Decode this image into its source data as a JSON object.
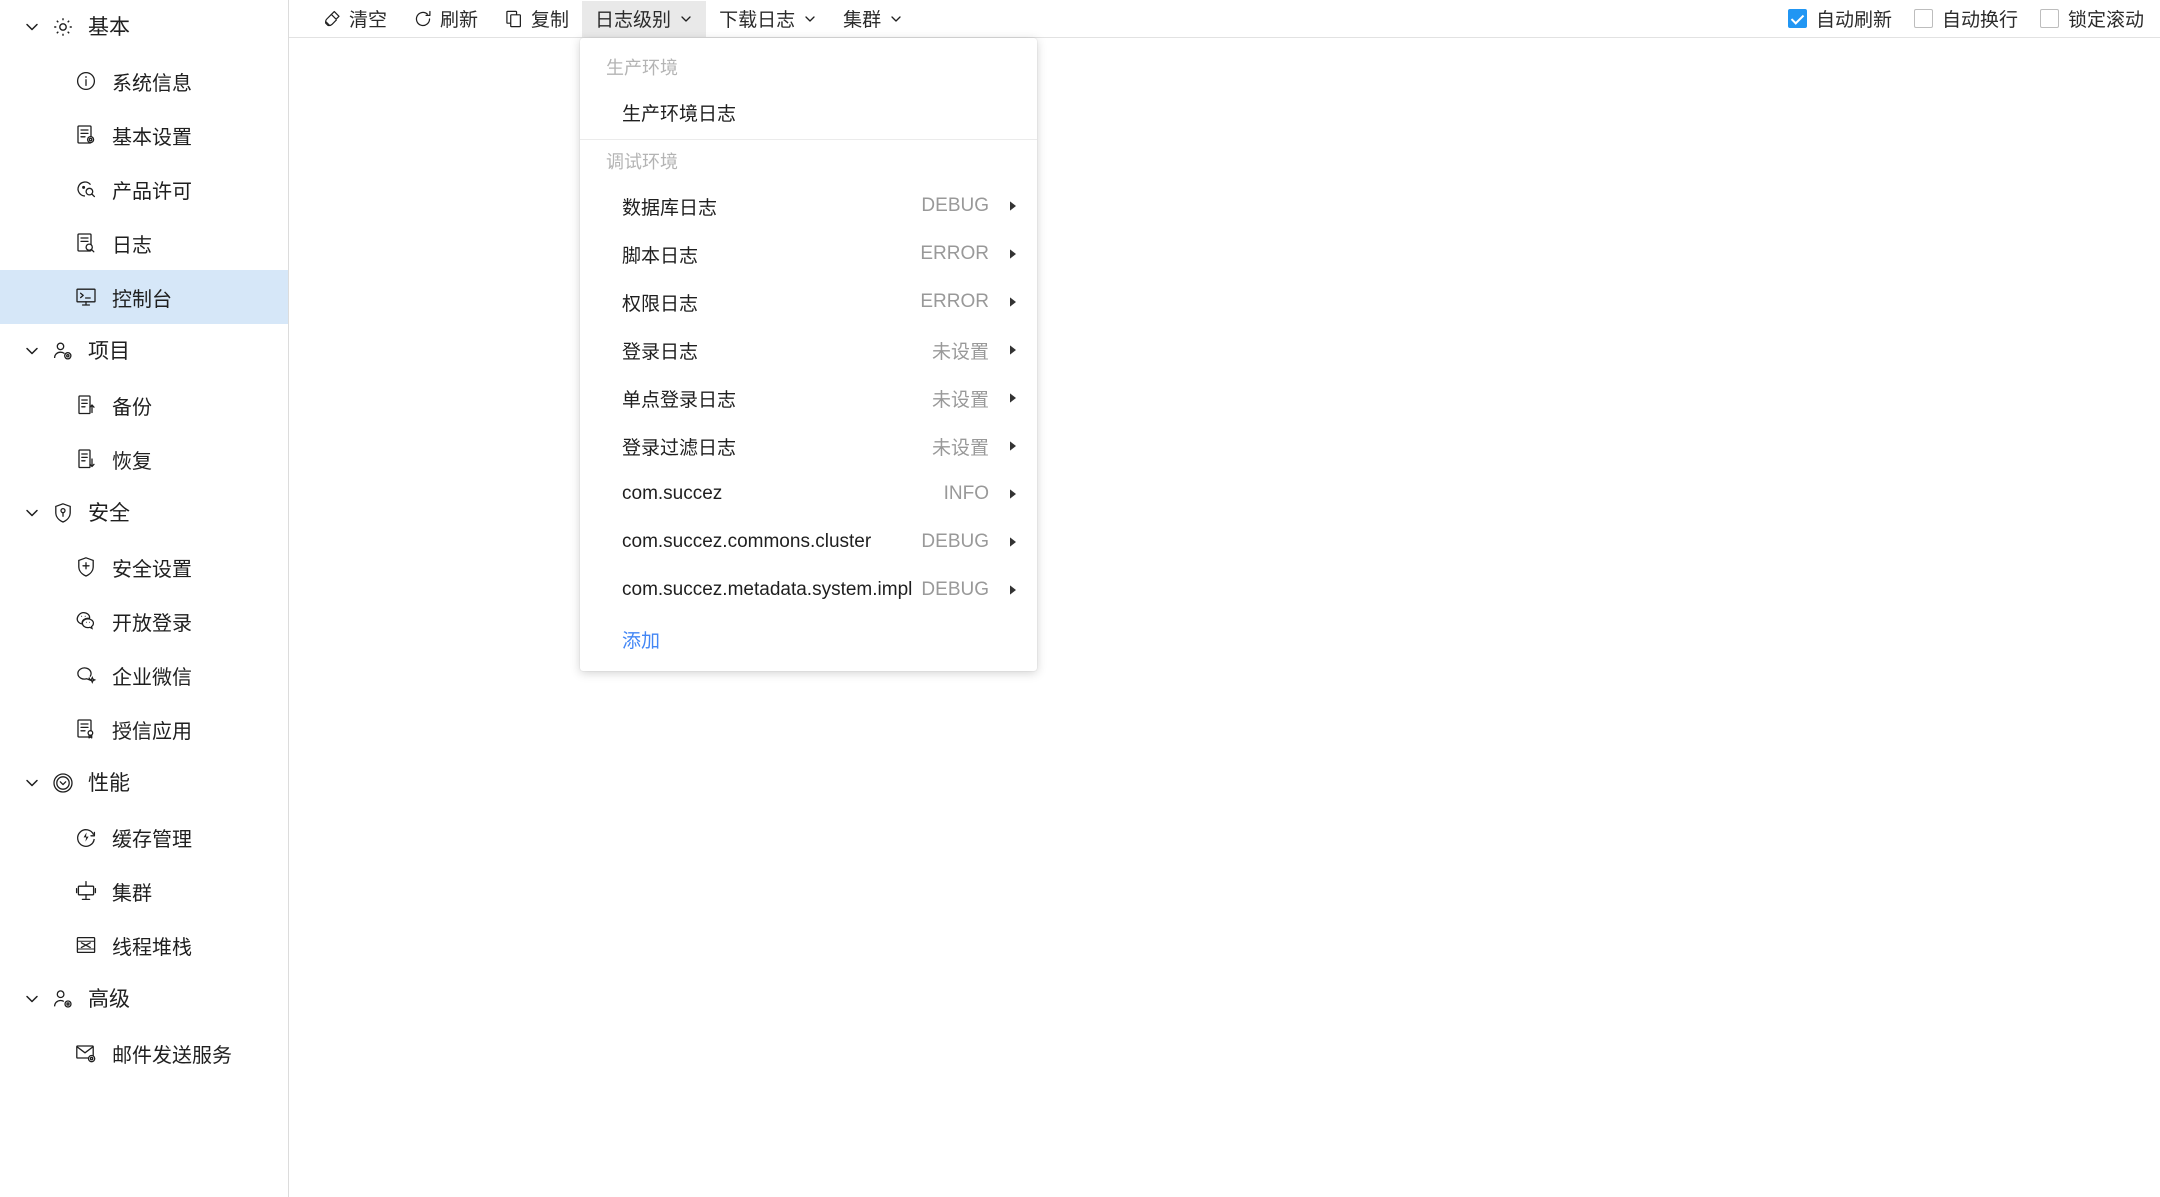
{
  "sidebar": {
    "groups": [
      {
        "label": "基本",
        "icon": "gear-icon",
        "expanded": true,
        "items": [
          {
            "label": "系统信息",
            "icon": "info-circle-icon",
            "selected": false
          },
          {
            "label": "基本设置",
            "icon": "doc-gear-icon",
            "selected": false
          },
          {
            "label": "产品许可",
            "icon": "license-key-icon",
            "selected": false
          },
          {
            "label": "日志",
            "icon": "doc-search-icon",
            "selected": false
          },
          {
            "label": "控制台",
            "icon": "console-monitor-icon",
            "selected": true
          }
        ]
      },
      {
        "label": "项目",
        "icon": "user-gear-icon",
        "expanded": true,
        "items": [
          {
            "label": "备份",
            "icon": "doc-up-arrow-icon",
            "selected": false
          },
          {
            "label": "恢复",
            "icon": "doc-down-arrow-icon",
            "selected": false
          }
        ]
      },
      {
        "label": "安全",
        "icon": "shield-key-icon",
        "expanded": true,
        "items": [
          {
            "label": "安全设置",
            "icon": "shield-plus-icon",
            "selected": false
          },
          {
            "label": "开放登录",
            "icon": "wechat-icon",
            "selected": false
          },
          {
            "label": "企业微信",
            "icon": "chat-sparkle-icon",
            "selected": false
          },
          {
            "label": "授信应用",
            "icon": "doc-badge-icon",
            "selected": false
          }
        ]
      },
      {
        "label": "性能",
        "icon": "performance-circle-icon",
        "expanded": true,
        "items": [
          {
            "label": "缓存管理",
            "icon": "flash-circle-icon",
            "selected": false
          },
          {
            "label": "集群",
            "icon": "cluster-icon",
            "selected": false
          },
          {
            "label": "线程堆栈",
            "icon": "thread-stack-icon",
            "selected": false
          }
        ]
      },
      {
        "label": "高级",
        "icon": "person-gear-icon",
        "expanded": true,
        "items": [
          {
            "label": "邮件发送服务",
            "icon": "mail-gear-icon",
            "selected": false
          }
        ]
      }
    ]
  },
  "toolbar": {
    "buttons": [
      {
        "label": "清空",
        "icon": "broom-icon",
        "has_caret": false,
        "active": false
      },
      {
        "label": "刷新",
        "icon": "refresh-icon",
        "has_caret": false,
        "active": false
      },
      {
        "label": "复制",
        "icon": "copy-icon",
        "has_caret": false,
        "active": false
      },
      {
        "label": "日志级别",
        "icon": "",
        "has_caret": true,
        "active": true
      },
      {
        "label": "下载日志",
        "icon": "",
        "has_caret": true,
        "active": false
      },
      {
        "label": "集群",
        "icon": "",
        "has_caret": true,
        "active": false
      }
    ],
    "checkboxes": [
      {
        "label": "自动刷新",
        "checked": true
      },
      {
        "label": "自动换行",
        "checked": false
      },
      {
        "label": "锁定滚动",
        "checked": false
      }
    ]
  },
  "dropdown": {
    "sections": [
      {
        "title": "生产环境",
        "items": [
          {
            "name": "生产环境日志",
            "level": "",
            "arrow": false
          }
        ]
      },
      {
        "title": "调试环境",
        "items": [
          {
            "name": "数据库日志",
            "level": "DEBUG",
            "arrow": true
          },
          {
            "name": "脚本日志",
            "level": "ERROR",
            "arrow": true
          },
          {
            "name": "权限日志",
            "level": "ERROR",
            "arrow": true
          },
          {
            "name": "登录日志",
            "level": "未设置",
            "arrow": true
          },
          {
            "name": "单点登录日志",
            "level": "未设置",
            "arrow": true
          },
          {
            "name": "登录过滤日志",
            "level": "未设置",
            "arrow": true
          },
          {
            "name": "com.succez",
            "level": "INFO",
            "arrow": true
          },
          {
            "name": "com.succez.commons.cluster",
            "level": "DEBUG",
            "arrow": true
          },
          {
            "name": "com.succez.metadata.system.impl",
            "level": "DEBUG",
            "arrow": true
          }
        ]
      }
    ],
    "add_label": "添加"
  },
  "colors": {
    "accent": "#2196f3",
    "link": "#4286f5",
    "selected_bg": "#d6e7f8",
    "muted": "#999999",
    "section_label": "#b4b4b4"
  }
}
